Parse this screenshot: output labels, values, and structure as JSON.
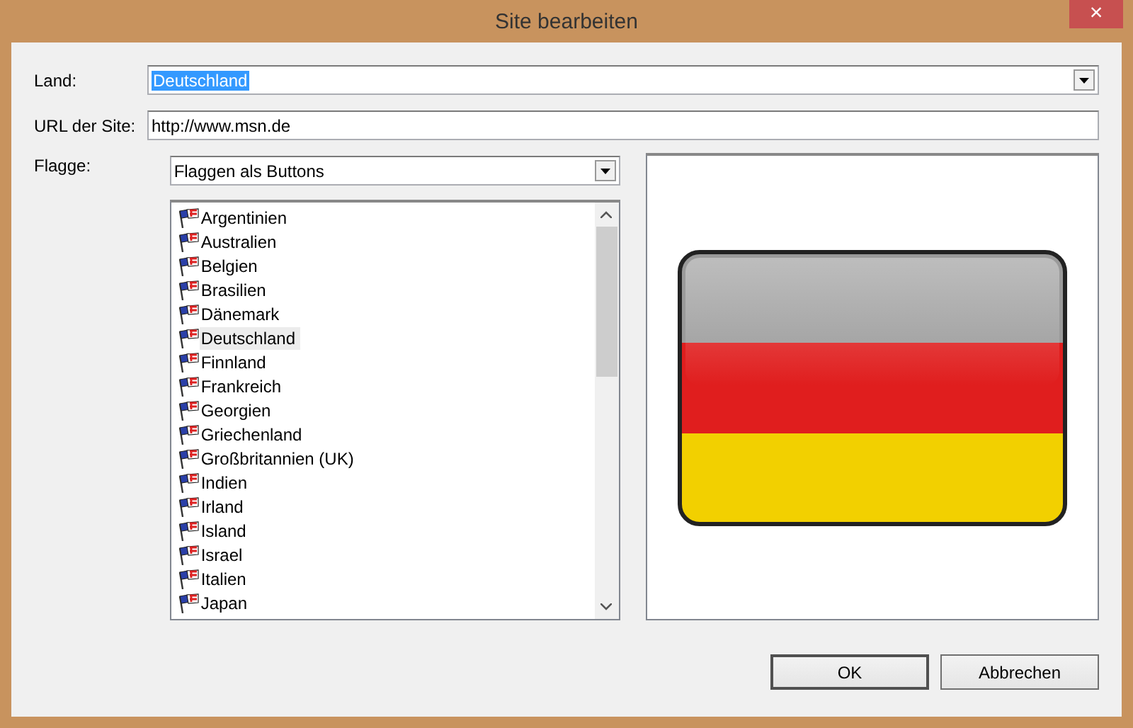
{
  "window": {
    "title": "Site bearbeiten",
    "close": "×"
  },
  "land": {
    "label": "Land:",
    "value": "Deutschland",
    "text_selected": true
  },
  "url": {
    "label": "URL der Site:",
    "value": "http://www.msn.de"
  },
  "flagge": {
    "label": "Flagge:",
    "value": "Flaggen als Buttons"
  },
  "countries": [
    {
      "name": "Argentinien",
      "selected": false
    },
    {
      "name": "Australien",
      "selected": false
    },
    {
      "name": "Belgien",
      "selected": false
    },
    {
      "name": "Brasilien",
      "selected": false
    },
    {
      "name": "Dänemark",
      "selected": false
    },
    {
      "name": "Deutschland",
      "selected": true
    },
    {
      "name": "Finnland",
      "selected": false
    },
    {
      "name": "Frankreich",
      "selected": false
    },
    {
      "name": "Georgien",
      "selected": false
    },
    {
      "name": "Griechenland",
      "selected": false
    },
    {
      "name": "Großbritannien (UK)",
      "selected": false
    },
    {
      "name": "Indien",
      "selected": false
    },
    {
      "name": "Irland",
      "selected": false
    },
    {
      "name": "Island",
      "selected": false
    },
    {
      "name": "Israel",
      "selected": false
    },
    {
      "name": "Italien",
      "selected": false
    },
    {
      "name": "Japan",
      "selected": false
    }
  ],
  "buttons": [
    "OK",
    "Abbrechen"
  ]
}
